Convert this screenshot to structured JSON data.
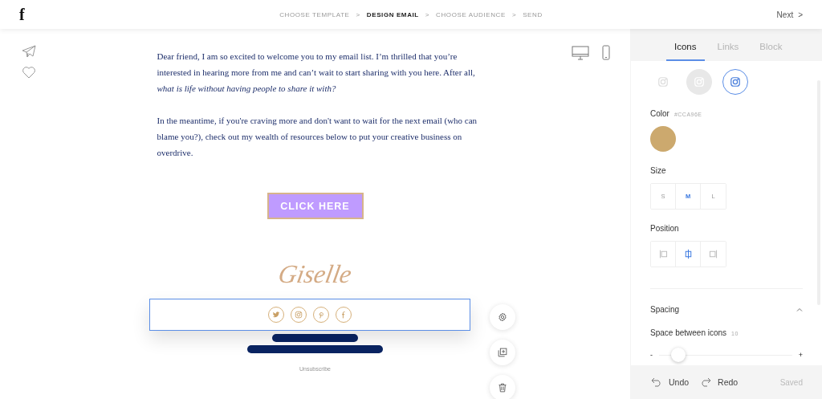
{
  "header": {
    "logo": "f",
    "steps": [
      {
        "label": "CHOOSE TEMPLATE",
        "selected": false
      },
      {
        "label": "DESIGN EMAIL",
        "selected": true
      },
      {
        "label": "CHOOSE AUDIENCE",
        "selected": false
      },
      {
        "label": "SEND",
        "selected": false
      }
    ],
    "separators": [
      ">",
      ">",
      ">"
    ],
    "next": {
      "label": "Next",
      "arrow": ">"
    }
  },
  "email": {
    "paragraphs": [
      "Dear friend, I am so excited to welcome you to my email list. I’m thrilled that you’re interested in hearing more from me and can’t wait to start sharing with you here. After all, *what is life without having people to share it with?*",
      "In the meantime, if you're craving more and don't want to wait for the next email (who can blame you?), check out my wealth of resources below to put your creative business on overdrive."
    ],
    "button": "CLICK HERE",
    "signature": "Giselle",
    "social_icons": [
      {
        "kind": "twitter"
      },
      {
        "kind": "instagram"
      },
      {
        "kind": "pinterest"
      },
      {
        "kind": "facebook"
      }
    ],
    "unsubscribe": "Unsubscribe"
  },
  "panel": {
    "tabs": [
      {
        "label": "Icons",
        "selected": true
      },
      {
        "label": "Links",
        "selected": false
      },
      {
        "label": "Block",
        "selected": false
      }
    ],
    "icon_styles": [
      {
        "kind": "plain",
        "selected": false
      },
      {
        "kind": "filled",
        "selected": false
      },
      {
        "kind": "outline",
        "selected": true
      }
    ],
    "color": {
      "label": "Color",
      "value": "#CCA96E",
      "color": "#cca96e"
    },
    "size": {
      "label": "Size",
      "options": [
        {
          "label": "S",
          "selected": false
        },
        {
          "label": "M",
          "selected": true
        },
        {
          "label": "L",
          "selected": false
        }
      ]
    },
    "position": {
      "label": "Position",
      "options": [
        {
          "kind": "left",
          "selected": false
        },
        {
          "kind": "center",
          "selected": true
        },
        {
          "kind": "right",
          "selected": false
        }
      ]
    },
    "spacing": {
      "title": "Spacing",
      "expanded": true,
      "label": "Space between icons",
      "value": "10",
      "minus": "-",
      "plus": "+",
      "level": 0.1
    },
    "footer": {
      "undo": "Undo",
      "redo": "Redo",
      "status": "Saved"
    }
  }
}
